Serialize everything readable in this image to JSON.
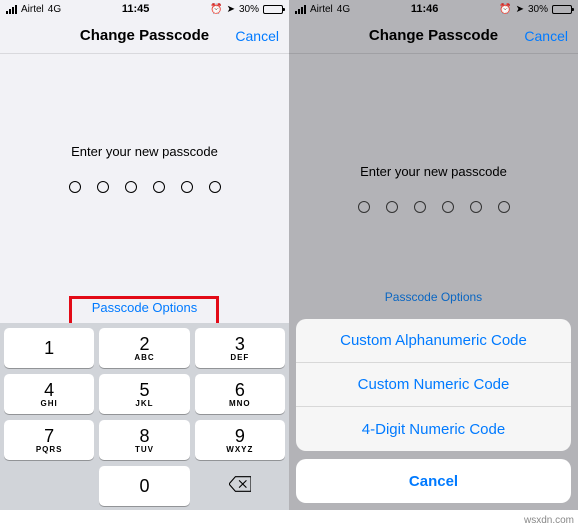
{
  "left": {
    "status": {
      "carrier": "Airtel",
      "network": "4G",
      "time": "11:45",
      "battery": "30%"
    },
    "nav": {
      "title": "Change Passcode",
      "cancel": "Cancel"
    },
    "prompt": "Enter your new passcode",
    "options_label": "Passcode Options",
    "keypad": [
      [
        {
          "d": "1",
          "l": ""
        },
        {
          "d": "2",
          "l": "ABC"
        },
        {
          "d": "3",
          "l": "DEF"
        }
      ],
      [
        {
          "d": "4",
          "l": "GHI"
        },
        {
          "d": "5",
          "l": "JKL"
        },
        {
          "d": "6",
          "l": "MNO"
        }
      ],
      [
        {
          "d": "7",
          "l": "PQRS"
        },
        {
          "d": "8",
          "l": "TUV"
        },
        {
          "d": "9",
          "l": "WXYZ"
        }
      ],
      [
        {
          "d": "",
          "l": ""
        },
        {
          "d": "0",
          "l": ""
        },
        {
          "d": "⌫",
          "l": ""
        }
      ]
    ]
  },
  "right": {
    "status": {
      "carrier": "Airtel",
      "network": "4G",
      "time": "11:46",
      "battery": "30%"
    },
    "nav": {
      "title": "Change Passcode",
      "cancel": "Cancel"
    },
    "prompt": "Enter your new passcode",
    "options_label": "Passcode Options",
    "sheet": {
      "items": [
        "Custom Alphanumeric Code",
        "Custom Numeric Code",
        "4-Digit Numeric Code"
      ],
      "cancel": "Cancel"
    }
  },
  "watermark": "wsxdn.com"
}
